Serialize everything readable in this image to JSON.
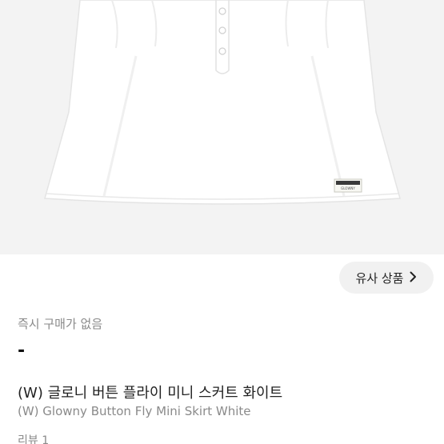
{
  "product_image": {
    "alt": "White mini skirt with button fly",
    "label_text": "GLOWNY"
  },
  "similar_button": {
    "label": "유사 상품",
    "icon": "chevron-right-icon"
  },
  "status": {
    "instant_purchase": "즉시 구매가 없음"
  },
  "price": {
    "value": "-"
  },
  "product": {
    "title_kr": "(W) 글로니 버튼 플라이 미니 스커트 화이트",
    "title_en": "(W) Glowny Button Fly Mini Skirt White"
  },
  "reviews": {
    "label": "리뷰 1"
  }
}
